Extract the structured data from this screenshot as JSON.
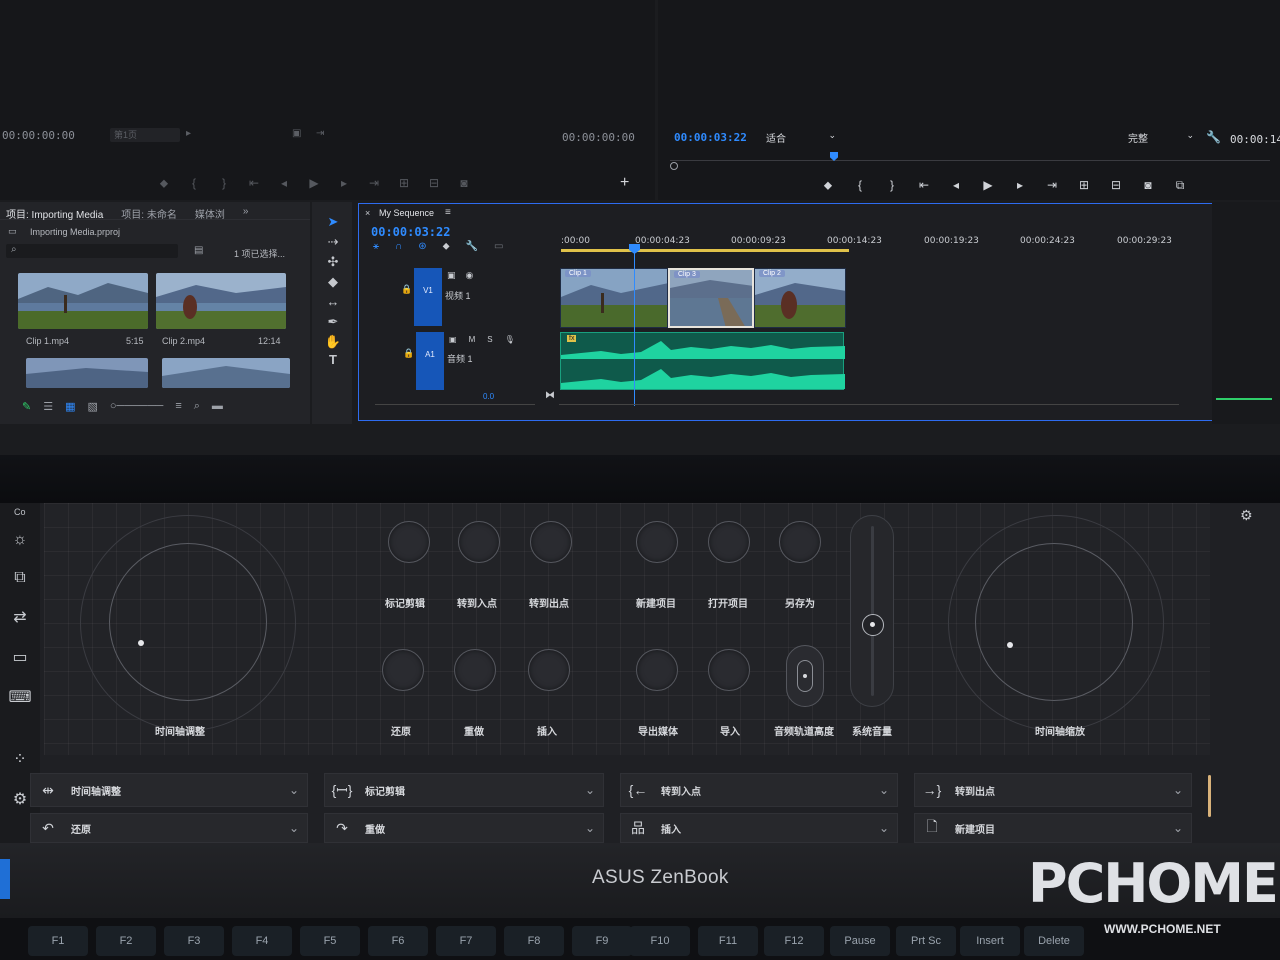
{
  "source_monitor": {
    "timecode": "00:00:00:00",
    "track_select": "第1页",
    "duration": "00:00:00:00"
  },
  "program_monitor": {
    "timecode": "00:00:03:22",
    "fit": "适合",
    "quality": "完整",
    "duration": "00:00:14"
  },
  "project_panel": {
    "tabs": [
      "项目: Importing Media",
      "项目: 未命名",
      "媒体浏"
    ],
    "file": "Importing Media.prproj",
    "selection": "1 项已选择...",
    "clips": [
      {
        "name": "Clip 1.mp4",
        "duration": "5:15"
      },
      {
        "name": "Clip 2.mp4",
        "duration": "12:14"
      }
    ]
  },
  "timeline": {
    "tab": "My Sequence",
    "timecode": "00:00:03:22",
    "ruler": [
      ":00:00",
      "00:00:04:23",
      "00:00:09:23",
      "00:00:14:23",
      "00:00:19:23",
      "00:00:24:23",
      "00:00:29:23"
    ],
    "video_track": {
      "id": "V1",
      "name": "视频 1"
    },
    "audio_track": {
      "id": "A1",
      "name": "音频 1",
      "level": "0.0"
    },
    "clips": [
      "Clip 1",
      "Clip 3",
      "Clip 2"
    ],
    "audio_label": "fx"
  },
  "control_panel": {
    "side_label": "Co",
    "dial_left": "时间轴调整",
    "dial_right": "时间轴缩放",
    "knobs_top": [
      "标记剪辑",
      "转到入点",
      "转到出点",
      "新建项目",
      "打开项目",
      "另存为"
    ],
    "knobs_bottom": [
      "还原",
      "重做",
      "插入",
      "导出媒体",
      "导入",
      "音频轨道高度"
    ],
    "slider": "系统音量",
    "bottom_row_1": [
      {
        "icon": "⇹",
        "label": "时间轴调整"
      },
      {
        "icon": "{ꟷ}",
        "label": "标记剪辑"
      },
      {
        "icon": "{←",
        "label": "转到入点"
      },
      {
        "icon": "→}",
        "label": "转到出点"
      }
    ],
    "bottom_row_2": [
      {
        "icon": "↶",
        "label": "还原"
      },
      {
        "icon": "↷",
        "label": "重做"
      },
      {
        "icon": "品",
        "label": "插入"
      },
      {
        "icon": "🗋",
        "label": "新建项目"
      }
    ]
  },
  "laptop": {
    "brand": "ASUS ZenBook",
    "keys": [
      "F1",
      "F2",
      "F3",
      "F4",
      "F5",
      "F6",
      "F7",
      "F8",
      "F9",
      "F10",
      "F11",
      "F12",
      "Pause",
      "Prt Sc",
      "Insert",
      "Delete"
    ]
  },
  "watermark": {
    "text": "PCHOME",
    "url": "WWW.PCHOME.NET"
  },
  "colors": {
    "accent": "#2f8bff",
    "audio_wave": "#1fd3a0",
    "track_header": "#1656b8"
  }
}
